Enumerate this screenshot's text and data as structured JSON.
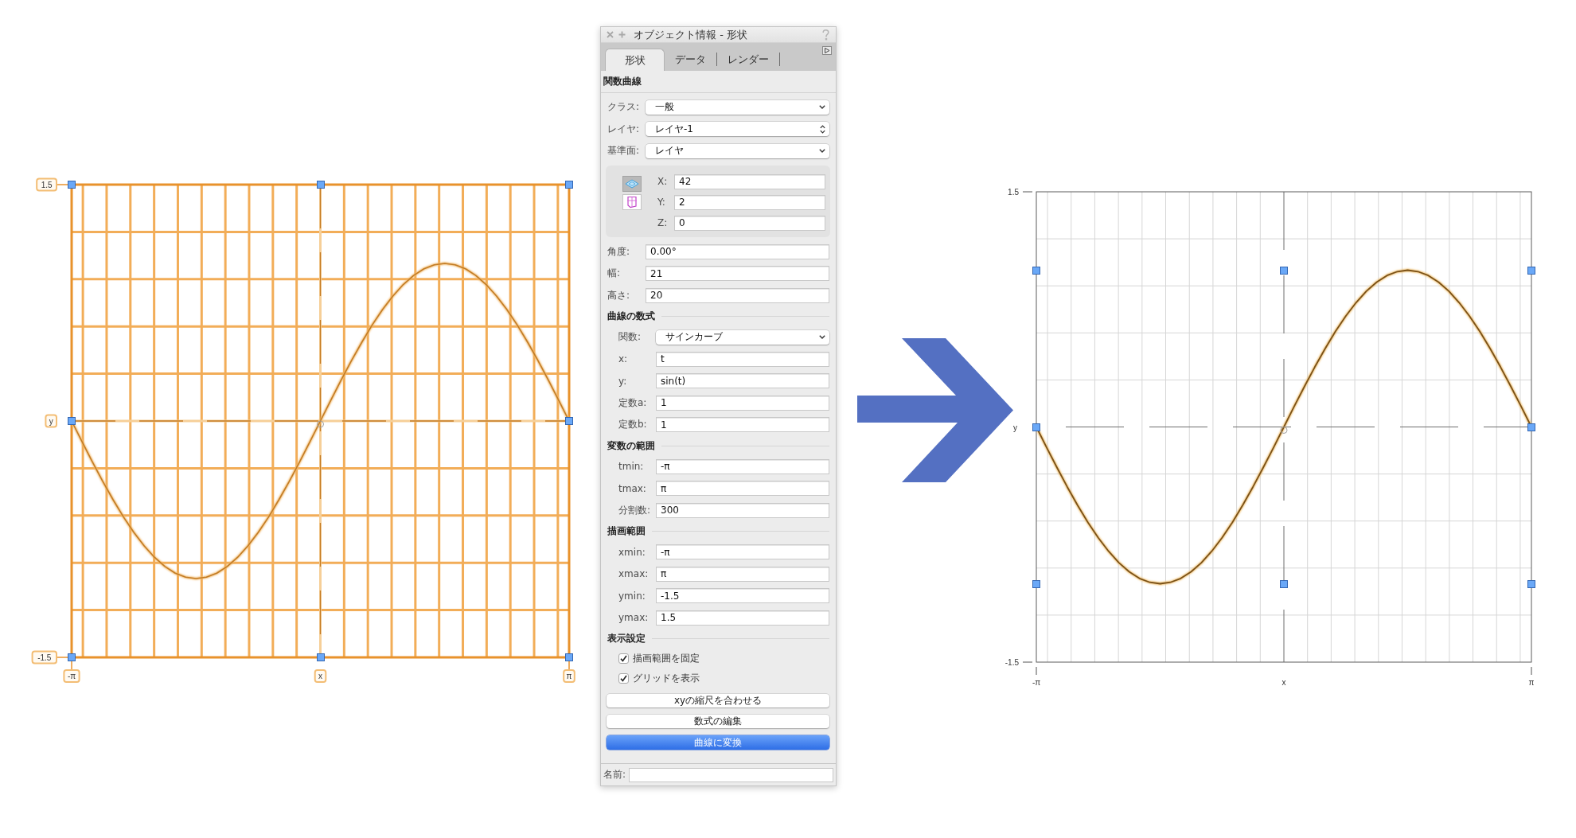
{
  "left_graph": {
    "highlighted": true,
    "chart_data": {
      "type": "line",
      "xlabel": "x",
      "ylabel": "y",
      "xlim": [
        -3.142,
        3.142
      ],
      "ylim": [
        -1.5,
        1.5
      ],
      "xticks": [
        {
          "value": -3.142,
          "label": "-π"
        },
        {
          "value": 3.142,
          "label": "π"
        }
      ],
      "yticks": [
        1.5,
        -1.5
      ],
      "x": [
        -3.142,
        -3.011,
        -2.88,
        -2.749,
        -2.618,
        -2.487,
        -2.356,
        -2.225,
        -2.094,
        -1.963,
        -1.833,
        -1.702,
        -1.571,
        -1.44,
        -1.309,
        -1.178,
        -1.047,
        -0.916,
        -0.785,
        -0.654,
        -0.524,
        -0.393,
        -0.262,
        -0.131,
        0,
        0.131,
        0.262,
        0.393,
        0.524,
        0.654,
        0.785,
        0.916,
        1.047,
        1.178,
        1.309,
        1.44,
        1.571,
        1.702,
        1.833,
        1.963,
        2.094,
        2.225,
        2.356,
        2.487,
        2.618,
        2.749,
        2.88,
        3.011,
        3.142
      ],
      "series": [
        {
          "values": [
            0,
            -0.131,
            -0.259,
            -0.383,
            -0.5,
            -0.609,
            -0.707,
            -0.793,
            -0.866,
            -0.924,
            -0.966,
            -0.991,
            -1,
            -0.991,
            -0.966,
            -0.924,
            -0.866,
            -0.793,
            -0.707,
            -0.609,
            -0.5,
            -0.383,
            -0.259,
            -0.131,
            0,
            0.131,
            0.259,
            0.383,
            0.5,
            0.609,
            0.707,
            0.793,
            0.866,
            0.924,
            0.966,
            0.991,
            1,
            0.991,
            0.966,
            0.924,
            0.866,
            0.793,
            0.707,
            0.609,
            0.5,
            0.383,
            0.259,
            0.131,
            0
          ]
        }
      ]
    }
  },
  "panel": {
    "title": "オブジェクト情報 - 形状",
    "tabs": [
      {
        "label": "形状",
        "selected": true
      },
      {
        "label": "データ",
        "selected": false
      },
      {
        "label": "レンダー",
        "selected": false
      }
    ],
    "object_type": "関数曲線",
    "general_rows": [
      {
        "kind": "dropdown",
        "label": "クラス:",
        "value": "一般"
      },
      {
        "kind": "stepper",
        "label": "レイヤ:",
        "value": "レイヤ-1"
      },
      {
        "kind": "dropdown",
        "label": "基準面:",
        "value": "レイヤ"
      }
    ],
    "plane_buttons": [
      {
        "kind": "layer",
        "selected": true
      },
      {
        "kind": "screen",
        "selected": false
      }
    ],
    "position_rows": [
      {
        "label": "X:",
        "value": "42"
      },
      {
        "label": "Y:",
        "value": "2"
      },
      {
        "label": "Z:",
        "value": "0"
      }
    ],
    "size_rows": [
      {
        "label": "角度:",
        "value": "0.00°"
      },
      {
        "label": "幅:",
        "value": "21"
      },
      {
        "label": "高さ:",
        "value": "20"
      }
    ],
    "sections": [
      {
        "title": "曲線の数式",
        "rows": [
          {
            "kind": "dropdown",
            "label": "関数:",
            "value": "サインカーブ"
          },
          {
            "kind": "field",
            "label": "x:",
            "value": "t"
          },
          {
            "kind": "field",
            "label": "y:",
            "value": "sin(t)"
          },
          {
            "kind": "field",
            "label": "定数a:",
            "value": "1"
          },
          {
            "kind": "field",
            "label": "定数b:",
            "value": "1"
          }
        ]
      },
      {
        "title": "変数の範囲",
        "rows": [
          {
            "kind": "field",
            "label": "tmin:",
            "value": "-π"
          },
          {
            "kind": "field",
            "label": "tmax:",
            "value": "π"
          },
          {
            "kind": "field",
            "label": "分割数:",
            "value": "300"
          }
        ]
      },
      {
        "title": "描画範囲",
        "rows": [
          {
            "kind": "field",
            "label": "xmin:",
            "value": "-π"
          },
          {
            "kind": "field",
            "label": "xmax:",
            "value": "π"
          },
          {
            "kind": "field",
            "label": "ymin:",
            "value": "-1.5"
          },
          {
            "kind": "field",
            "label": "ymax:",
            "value": "1.5"
          }
        ]
      },
      {
        "title": "表示設定",
        "rows": [
          {
            "kind": "checkbox",
            "label": "描画範囲を固定",
            "checked": true
          },
          {
            "kind": "checkbox",
            "label": "グリッドを表示",
            "checked": true
          }
        ]
      }
    ],
    "buttons": [
      {
        "kind": "default",
        "label": "xyの縮尺を合わせる"
      },
      {
        "kind": "default",
        "label": "数式の編集"
      },
      {
        "kind": "primary",
        "label": "曲線に変換"
      }
    ],
    "name_field": {
      "label": "名前:"
    }
  },
  "right_graph": {
    "highlighted": false,
    "chart_data": {
      "type": "line",
      "xlabel": "x",
      "ylabel": "y",
      "xlim": [
        -3.142,
        3.142
      ],
      "ylim": [
        -1.5,
        1.5
      ],
      "xticks": [
        {
          "value": -3.142,
          "label": "-π"
        },
        {
          "value": 3.142,
          "label": "π"
        }
      ],
      "yticks": [
        1.5,
        -1.5
      ],
      "x": [
        -3.142,
        -3.011,
        -2.88,
        -2.749,
        -2.618,
        -2.487,
        -2.356,
        -2.225,
        -2.094,
        -1.963,
        -1.833,
        -1.702,
        -1.571,
        -1.44,
        -1.309,
        -1.178,
        -1.047,
        -0.916,
        -0.785,
        -0.654,
        -0.524,
        -0.393,
        -0.262,
        -0.131,
        0,
        0.131,
        0.262,
        0.393,
        0.524,
        0.654,
        0.785,
        0.916,
        1.047,
        1.178,
        1.309,
        1.44,
        1.571,
        1.702,
        1.833,
        1.963,
        2.094,
        2.225,
        2.356,
        2.487,
        2.618,
        2.749,
        2.88,
        3.011,
        3.142
      ],
      "series": [
        {
          "values": [
            0,
            -0.131,
            -0.259,
            -0.383,
            -0.5,
            -0.609,
            -0.707,
            -0.793,
            -0.866,
            -0.924,
            -0.966,
            -0.991,
            -1,
            -0.991,
            -0.966,
            -0.924,
            -0.866,
            -0.793,
            -0.707,
            -0.609,
            -0.5,
            -0.383,
            -0.259,
            -0.131,
            0,
            0.131,
            0.259,
            0.383,
            0.5,
            0.609,
            0.707,
            0.793,
            0.866,
            0.924,
            0.966,
            0.991,
            1,
            0.991,
            0.966,
            0.924,
            0.866,
            0.793,
            0.707,
            0.609,
            0.5,
            0.383,
            0.259,
            0.131,
            0
          ]
        }
      ]
    }
  }
}
